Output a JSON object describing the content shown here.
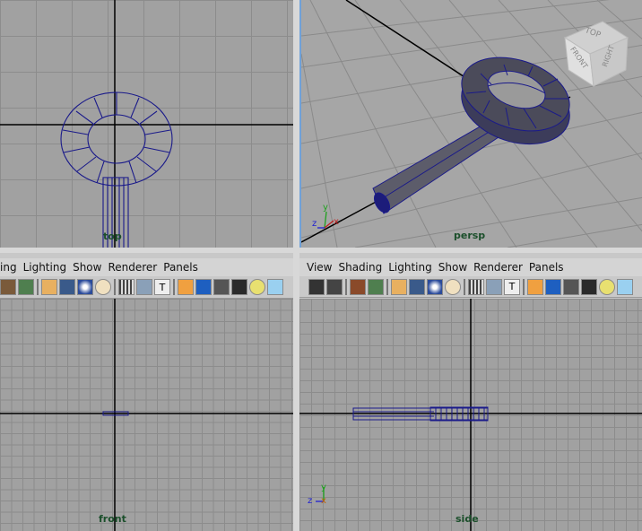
{
  "viewports": {
    "top": {
      "label": "top"
    },
    "persp": {
      "label": "persp",
      "view_cube": {
        "top": "TOP",
        "front": "FRONT",
        "right": "RIGHT"
      }
    },
    "front": {
      "label": "front"
    },
    "side": {
      "label": "side"
    }
  },
  "menus": {
    "front_panel": [
      "ing",
      "Lighting",
      "Show",
      "Renderer",
      "Panels"
    ],
    "side_panel": [
      "View",
      "Shading",
      "Lighting",
      "Show",
      "Renderer",
      "Panels"
    ]
  },
  "axes": {
    "y": "y",
    "z": "z",
    "x": "x"
  },
  "icons": {
    "front_toolbar": [
      "shade-icon",
      "grid-vis-icon",
      "sep",
      "lights-icon",
      "smooth-icon",
      "sphere-icon",
      "flat-icon",
      "sep",
      "tex-icon",
      "uv-icon",
      "text-icon",
      "sep",
      "wire-cube-icon",
      "blue-cube-icon",
      "gray-cube-icon",
      "dark-cube-icon",
      "bulb-icon",
      "cyan-cube-icon"
    ],
    "side_toolbar": [
      "camera-icon",
      "camera-film-icon",
      "sep",
      "book-icon",
      "shade-icon",
      "sep",
      "lights-icon",
      "smooth-icon",
      "sphere-icon",
      "flat-icon",
      "sep",
      "tex-icon",
      "uv-icon",
      "text-icon",
      "sep",
      "wire-cube-icon",
      "blue-cube-icon",
      "gray-cube-icon",
      "dark-cube-icon",
      "bulb-icon",
      "cyan-cube-icon"
    ]
  },
  "colors": {
    "wire": "#1a1a8a",
    "axis_line": "#000000",
    "label": "#1b4f2b",
    "active_border": "#6fa1d8"
  }
}
